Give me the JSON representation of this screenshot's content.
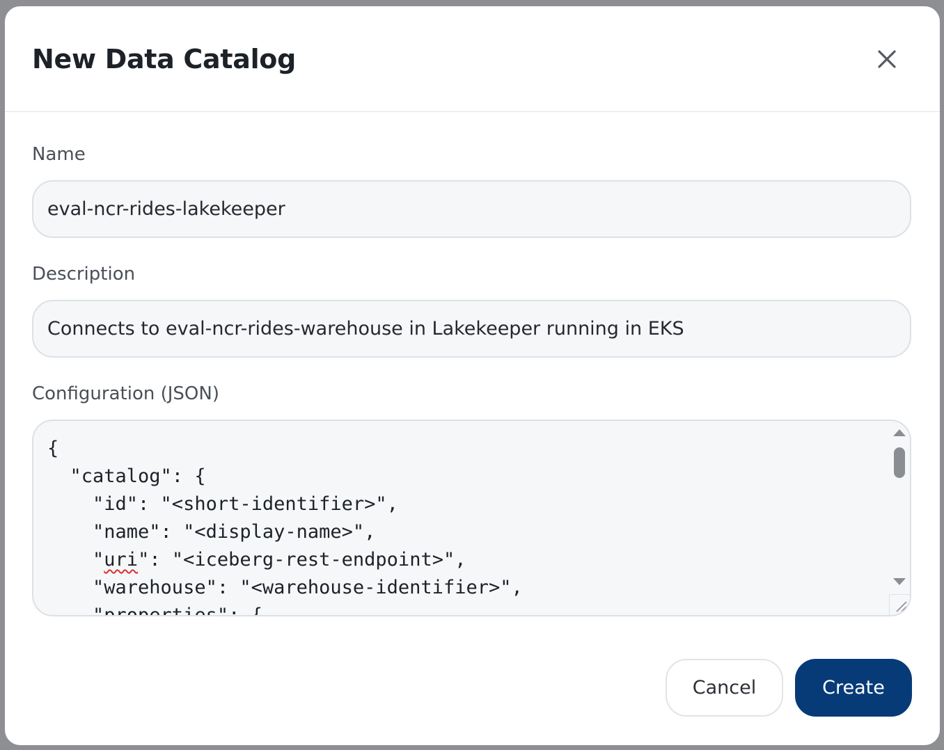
{
  "dialog": {
    "title": "New Data Catalog"
  },
  "fields": {
    "name": {
      "label": "Name",
      "value": "eval-ncr-rides-lakekeeper"
    },
    "description": {
      "label": "Description",
      "value": "Connects to eval-ncr-rides-warehouse in Lakekeeper running in EKS"
    },
    "configuration": {
      "label": "Configuration (JSON)",
      "lines": {
        "l1": "{",
        "l2": "  \"catalog\": {",
        "l3": "    \"id\": \"<short-identifier>\",",
        "l4a": "    \"",
        "l4b": "uri",
        "l4c": "\": \"<iceberg-rest-endpoint>\",",
        "l5": "    \"name\": \"<display-name>\",",
        "l6": "    \"warehouse\": \"<warehouse-identifier>\",",
        "l7": "    \"properties\": {"
      }
    }
  },
  "buttons": {
    "cancel": "Cancel",
    "create": "Create"
  },
  "icons": {
    "close": "close-icon",
    "scroll_up": "scroll-up-arrow-icon",
    "scroll_down": "scroll-down-arrow-icon",
    "resize": "resize-grip-icon"
  },
  "colors": {
    "primary": "#073b78",
    "backdrop": "#8e8f93"
  }
}
